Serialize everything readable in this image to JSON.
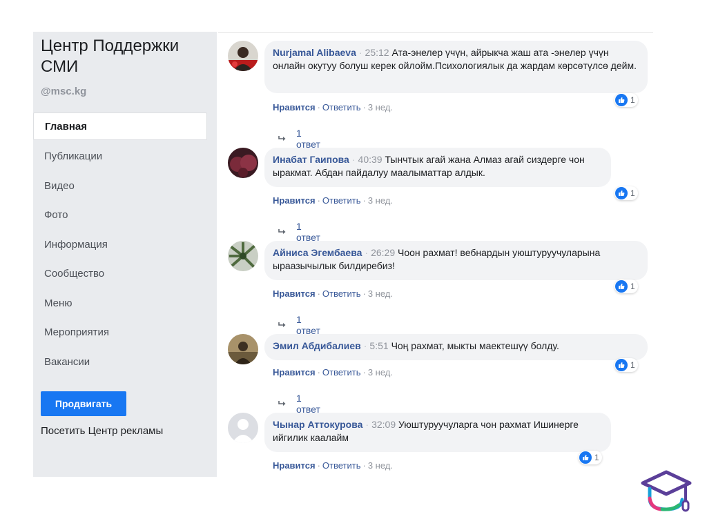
{
  "sidebar": {
    "page_name": "Центр Поддержки СМИ",
    "handle": "@msc.kg",
    "items": [
      {
        "label": "Главная"
      },
      {
        "label": "Публикации"
      },
      {
        "label": "Видео"
      },
      {
        "label": "Фото"
      },
      {
        "label": "Информация"
      },
      {
        "label": "Сообщество"
      },
      {
        "label": "Меню"
      },
      {
        "label": "Мероприятия"
      },
      {
        "label": "Вакансии"
      }
    ],
    "promote_label": "Продвигать",
    "ad_center_label": "Посетить Центр рекламы"
  },
  "ui": {
    "like_label": "Нравится",
    "reply_label": "Ответить",
    "accent": "#1877f2",
    "link_color": "#385898"
  },
  "comments": [
    {
      "author": "Nurjamal Alibaeva",
      "timecode": "25:12",
      "text": "Ата-энелер үчүн, айрыкча жаш ата -энелер үчүн онлайн окутуу болуш керек ойлойм.Психологиялык да жардам көрсөтүлсө дейм.",
      "reactions": "1",
      "age": "3 нед.",
      "replies": "1 ответ"
    },
    {
      "author": "Инабат Гаипова",
      "timecode": "40:39",
      "text": "Тынчтык агай жана Алмаз агай сиздерге чон ыракмат. Абдан пайдалуу маалыматтар алдык.",
      "reactions": "1",
      "age": "3 нед.",
      "replies": "1 ответ"
    },
    {
      "author": "Айниса Эгембаева",
      "timecode": "26:29",
      "text": "Чоон рахмат! вебнардын уюштуруучуларына ыраазычылык билдиребиз!",
      "reactions": "1",
      "age": "3 нед.",
      "replies": "1 ответ"
    },
    {
      "author": "Эмил Абдибалиев",
      "timecode": "5:51",
      "text": "Чоң рахмат, мыкты маектешүү болду.",
      "reactions": "1",
      "age": "3 нед.",
      "replies": "1 ответ"
    },
    {
      "author": "Чынар Аттокурова",
      "timecode": "32:09",
      "text": "Уюштуруучуларга чон рахмат Ишинерге ийгилик каалайм",
      "reactions": "1",
      "age": "3 нед."
    }
  ]
}
